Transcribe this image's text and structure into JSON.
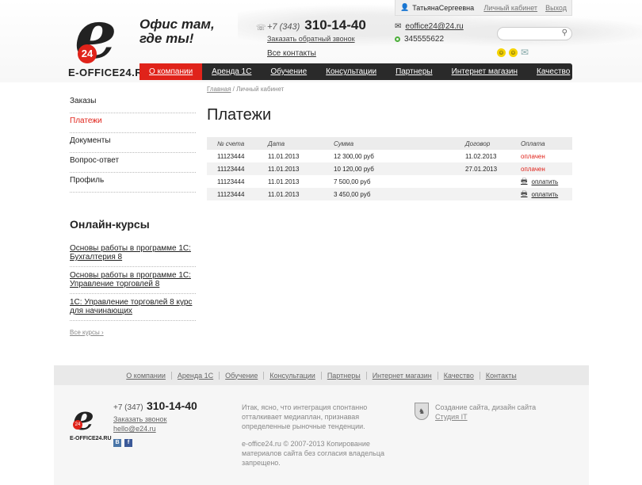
{
  "brand": {
    "logo_mark": "e",
    "logo_badge": "24",
    "logo_text": "E-OFFICE24.RU",
    "slogan_line1": "Офис там,",
    "slogan_line2": "где ты!"
  },
  "header": {
    "phone_code": "+7 (343)",
    "phone_number": "310-14-40",
    "callback": "Заказать обратный звонок",
    "contacts": "Все контакты",
    "user": "ТатьянаСергеевна",
    "cabinet": "Личный кабинет",
    "exit": "Выход",
    "email": "eoffice24@24.ru",
    "icq": "345555622",
    "search_placeholder": ""
  },
  "nav": {
    "items": [
      "О компании",
      "Аренда 1С",
      "Обучение",
      "Консультации",
      "Партнеры",
      "Интернет магазин",
      "Качество"
    ],
    "active": 0
  },
  "sidebar": {
    "items": [
      "Заказы",
      "Платежи",
      "Документы",
      "Вопрос-ответ",
      "Профиль"
    ],
    "active": 1,
    "courses_title": "Онлайн-курсы",
    "courses": [
      "Основы работы в программе 1С: Бухгалтерия 8",
      "Основы работы в программе 1С: Управление торговлей 8",
      "1С: Управление торговлей 8 курс для начинающих"
    ],
    "all_courses": "Все курсы"
  },
  "main": {
    "breadcrumb_home": "Главная",
    "breadcrumb_sep": " / ",
    "breadcrumb_current": "Личный кабинет",
    "title": "Платежи",
    "columns": [
      "№ счета",
      "Дата",
      "Сумма",
      "Договор",
      "Оплата"
    ],
    "rows": [
      {
        "invoice": "11123444",
        "date": "11.01.2013",
        "sum": "12 300,00 руб",
        "contract": "11.02.2013",
        "status": "оплачен",
        "paid": true
      },
      {
        "invoice": "11123444",
        "date": "11.01.2013",
        "sum": "10 120,00 руб",
        "contract": "27.01.2013",
        "status": "оплачен",
        "paid": true
      },
      {
        "invoice": "11123444",
        "date": "11.01.2013",
        "sum": "7 500,00 руб",
        "contract": "",
        "status": "оплатить",
        "paid": false
      },
      {
        "invoice": "11123444",
        "date": "11.01.2013",
        "sum": "3 450,00 руб",
        "contract": "",
        "status": "оплатить",
        "paid": false
      }
    ]
  },
  "footer": {
    "nav": [
      "О компании",
      "Аренда 1С",
      "Обучение",
      "Консультации",
      "Партнеры",
      "Интернет магазин",
      "Качество",
      "Контакты"
    ],
    "logo_text": "E-OFFICE24.RU",
    "phone_code": "+7 (347)",
    "phone_number": "310-14-40",
    "callback": "Заказать звонок",
    "email": "hello@e24.ru",
    "vk": "В",
    "fb": "f",
    "text1": "Итак, ясно, что интеграция спонтанно отталкивает медиаплан, признавая определенные рыночные тенденции.",
    "text2": "e-office24.ru © 2007-2013 Копирование материалов сайта без согласия владельца запрещено.",
    "studio_text": "Создание сайта, дизайн сайта",
    "studio_link": "Студия IT"
  }
}
